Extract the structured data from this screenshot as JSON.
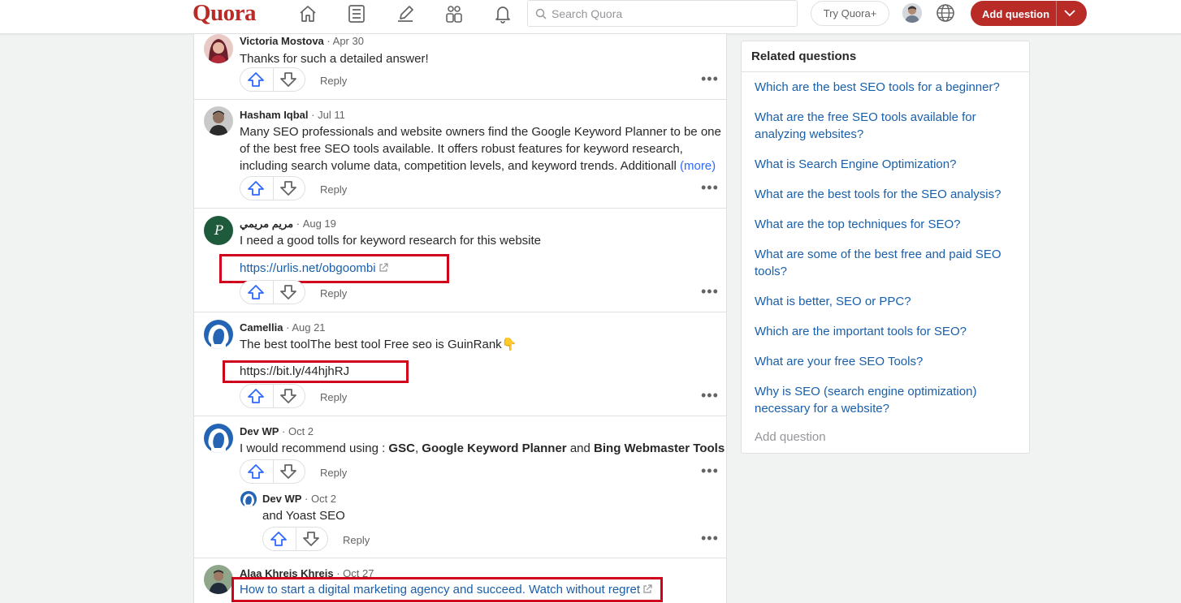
{
  "header": {
    "logo": "Quora",
    "search_placeholder": "Search Quora",
    "try_label": "Try Quora+",
    "add_question_label": "Add question",
    "icons": [
      "home-icon",
      "following-icon",
      "answer-icon",
      "spaces-icon",
      "notifications-icon"
    ]
  },
  "comments": [
    {
      "name": "Victoria Mostova",
      "date": "· Apr 30",
      "text": "Thanks for such a detailed answer!",
      "reply": "Reply"
    },
    {
      "name": "Hasham Iqbal",
      "date": "· Jul 11",
      "lines": [
        "Many SEO professionals and website owners find the Google Keyword Planner to be one",
        "of the best free SEO tools available. It offers robust features for keyword research,",
        "including search volume data, competition levels, and keyword trends. Additionall"
      ],
      "more": "(more)",
      "reply": "Reply"
    },
    {
      "name": "مريم مريمي",
      "date": "· Aug 19",
      "avatar_letter": "P",
      "text": "I need a good tolls for keyword research for this website",
      "link": "https://urlis.net/obgoombi",
      "reply": "Reply"
    },
    {
      "name": "Camellia",
      "date": "· Aug 21",
      "text": "The best toolThe best tool Free seo is GuinRank👇",
      "link": "https://bit.ly/44hjhRJ",
      "reply": "Reply"
    },
    {
      "name": "Dev WP",
      "date": "· Oct 2",
      "text_prefix": "I would recommend using : ",
      "bold1": "GSC",
      "sep1": ", ",
      "bold2": "Google Keyword Planner",
      "sep2": " and ",
      "bold3": "Bing Webmaster Tools",
      "reply": "Reply",
      "nested": {
        "name": "Dev WP",
        "date": "· Oct 2",
        "text": "and Yoast SEO",
        "reply": "Reply"
      }
    },
    {
      "name": "Alaa Khreis Khreis",
      "date": "· Oct 27",
      "link": "How to start a digital marketing agency and succeed. Watch without regret"
    }
  ],
  "related": {
    "title": "Related questions",
    "questions": [
      "Which are the best SEO tools for a beginner?",
      "What are the free SEO tools available for analyzing websites?",
      "What is Search Engine Optimization?",
      "What are the best tools for the SEO analysis?",
      "What are the top techniques for SEO?",
      "What are some of the best free and paid SEO tools?",
      "What is better, SEO or PPC?",
      "Which are the important tools for SEO?",
      "What are your free SEO Tools?",
      "Why is SEO (search engine optimization) necessary for a website?"
    ],
    "add_question": "Add question"
  },
  "colors": {
    "brand": "#b92b27",
    "link": "#195faa",
    "upvote": "#2e69ff",
    "highlight_box": "#d0021b"
  }
}
